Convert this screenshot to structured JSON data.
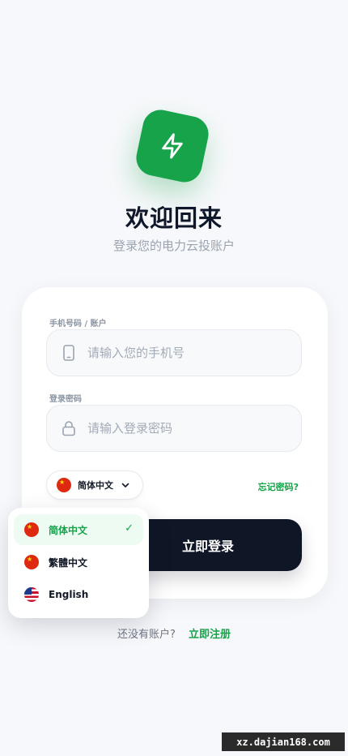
{
  "brand": {
    "icon": "lightning-bolt-icon",
    "accent": "#16a34a"
  },
  "header": {
    "title": "欢迎回来",
    "subtitle": "登录您的电力云投账户"
  },
  "form": {
    "phone_label": "手机号码 / 账户",
    "phone_placeholder": "请输入您的手机号",
    "password_label": "登录密码",
    "password_placeholder": "请输入登录密码",
    "language_selected": "简体中文",
    "forgot_label": "忘记密码?",
    "login_label": "立即登录"
  },
  "language_menu": [
    {
      "label": "简体中文",
      "flag": "cn-flag-icon",
      "selected": true
    },
    {
      "label": "繁體中文",
      "flag": "cn-flag-icon",
      "selected": false
    },
    {
      "label": "English",
      "flag": "us-flag-icon",
      "selected": false
    }
  ],
  "footer": {
    "no_account": "还没有账户?",
    "register_label": "立即注册"
  },
  "watermark": "xz.dajian168.com"
}
